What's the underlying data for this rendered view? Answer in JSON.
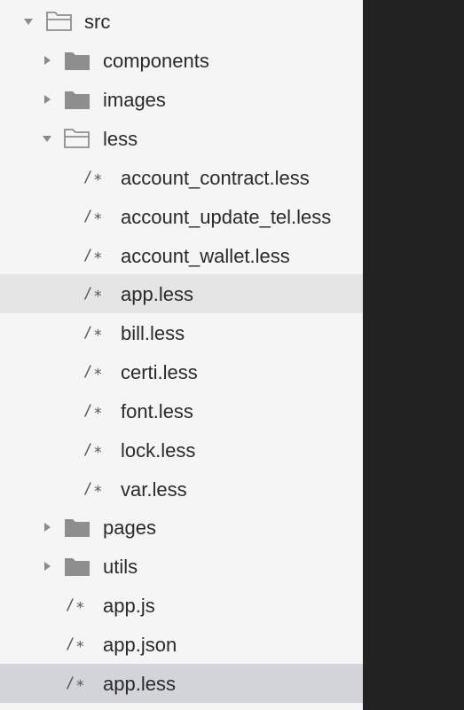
{
  "tree": {
    "src": {
      "label": "src",
      "icon": "folder-open-icon",
      "expanded": true
    },
    "components": {
      "label": "components",
      "icon": "folder-icon",
      "expanded": false
    },
    "images": {
      "label": "images",
      "icon": "folder-icon",
      "expanded": false
    },
    "less": {
      "label": "less",
      "icon": "folder-open-icon",
      "expanded": true,
      "file_icon": "/∗",
      "files": [
        "account_contract.less",
        "account_update_tel.less",
        "account_wallet.less",
        "app.less",
        "bill.less",
        "certi.less",
        "font.less",
        "lock.less",
        "var.less"
      ]
    },
    "pages": {
      "label": "pages",
      "icon": "folder-icon",
      "expanded": false
    },
    "utils": {
      "label": "utils",
      "icon": "folder-icon",
      "expanded": false
    },
    "root_files": [
      "app.js",
      "app.json",
      "app.less"
    ],
    "file_icon": "/∗"
  },
  "colors": {
    "sidebar_bg": "#f5f5f5",
    "editor_bg": "#222222",
    "selected_bg": "#d2d4d9",
    "hover_bg": "#e5e5e6",
    "folder_fill": "#8e8e8e"
  }
}
